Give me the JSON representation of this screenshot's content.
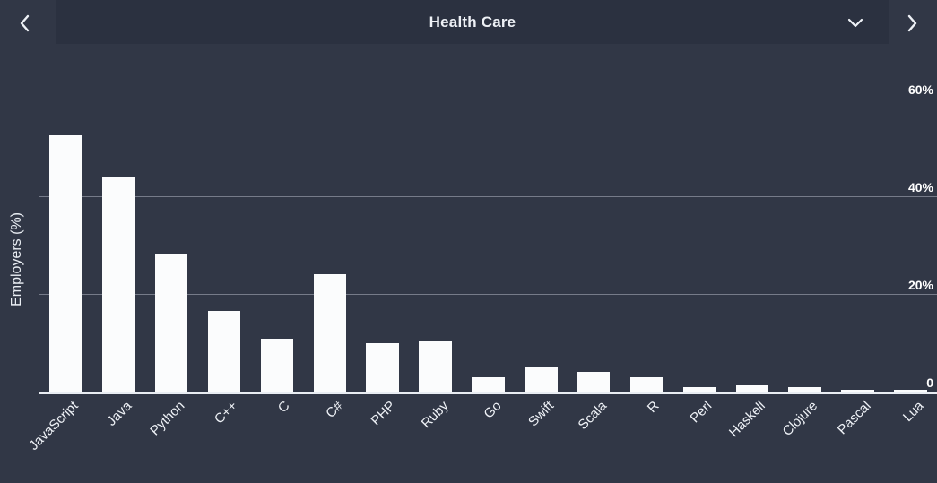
{
  "header": {
    "prev_label": "‹",
    "next_label": "›",
    "prev_icon": "chevron-left-icon",
    "next_icon": "chevron-right-icon",
    "caret_icon": "chevron-down-icon",
    "selected_option": "Health Care"
  },
  "colors": {
    "background": "#313746",
    "header_select_bg": "#2b3140",
    "bar": "#fbfcfd",
    "gridline": "#8e93a0",
    "axis": "#e9edf3",
    "text": "#eef1f6"
  },
  "chart_data": {
    "type": "bar",
    "title": "Health Care",
    "xlabel": "",
    "ylabel": "Employers (%)",
    "ylim": [
      0,
      60
    ],
    "yticks": [
      0,
      20,
      40,
      60
    ],
    "ytick_labels": [
      "0",
      "20%",
      "40%",
      "60%"
    ],
    "grid": true,
    "legend": "none",
    "categories": [
      "JavaScript",
      "Java",
      "Python",
      "C++",
      "C",
      "C#",
      "PHP",
      "Ruby",
      "Go",
      "Swift",
      "Scala",
      "R",
      "Perl",
      "Haskell",
      "Clojure",
      "Pascal",
      "Lua"
    ],
    "values": [
      52.5,
      44,
      28,
      16.5,
      10.8,
      24,
      10,
      10.5,
      3,
      5,
      4,
      3,
      1,
      1.2,
      1,
      0.4,
      0.3
    ],
    "series": [
      {
        "name": "Employers (%)",
        "values": [
          52.5,
          44,
          28,
          16.5,
          10.8,
          24,
          10,
          10.5,
          3,
          5,
          4,
          3,
          1,
          1.2,
          1,
          0.4,
          0.3
        ]
      }
    ]
  }
}
